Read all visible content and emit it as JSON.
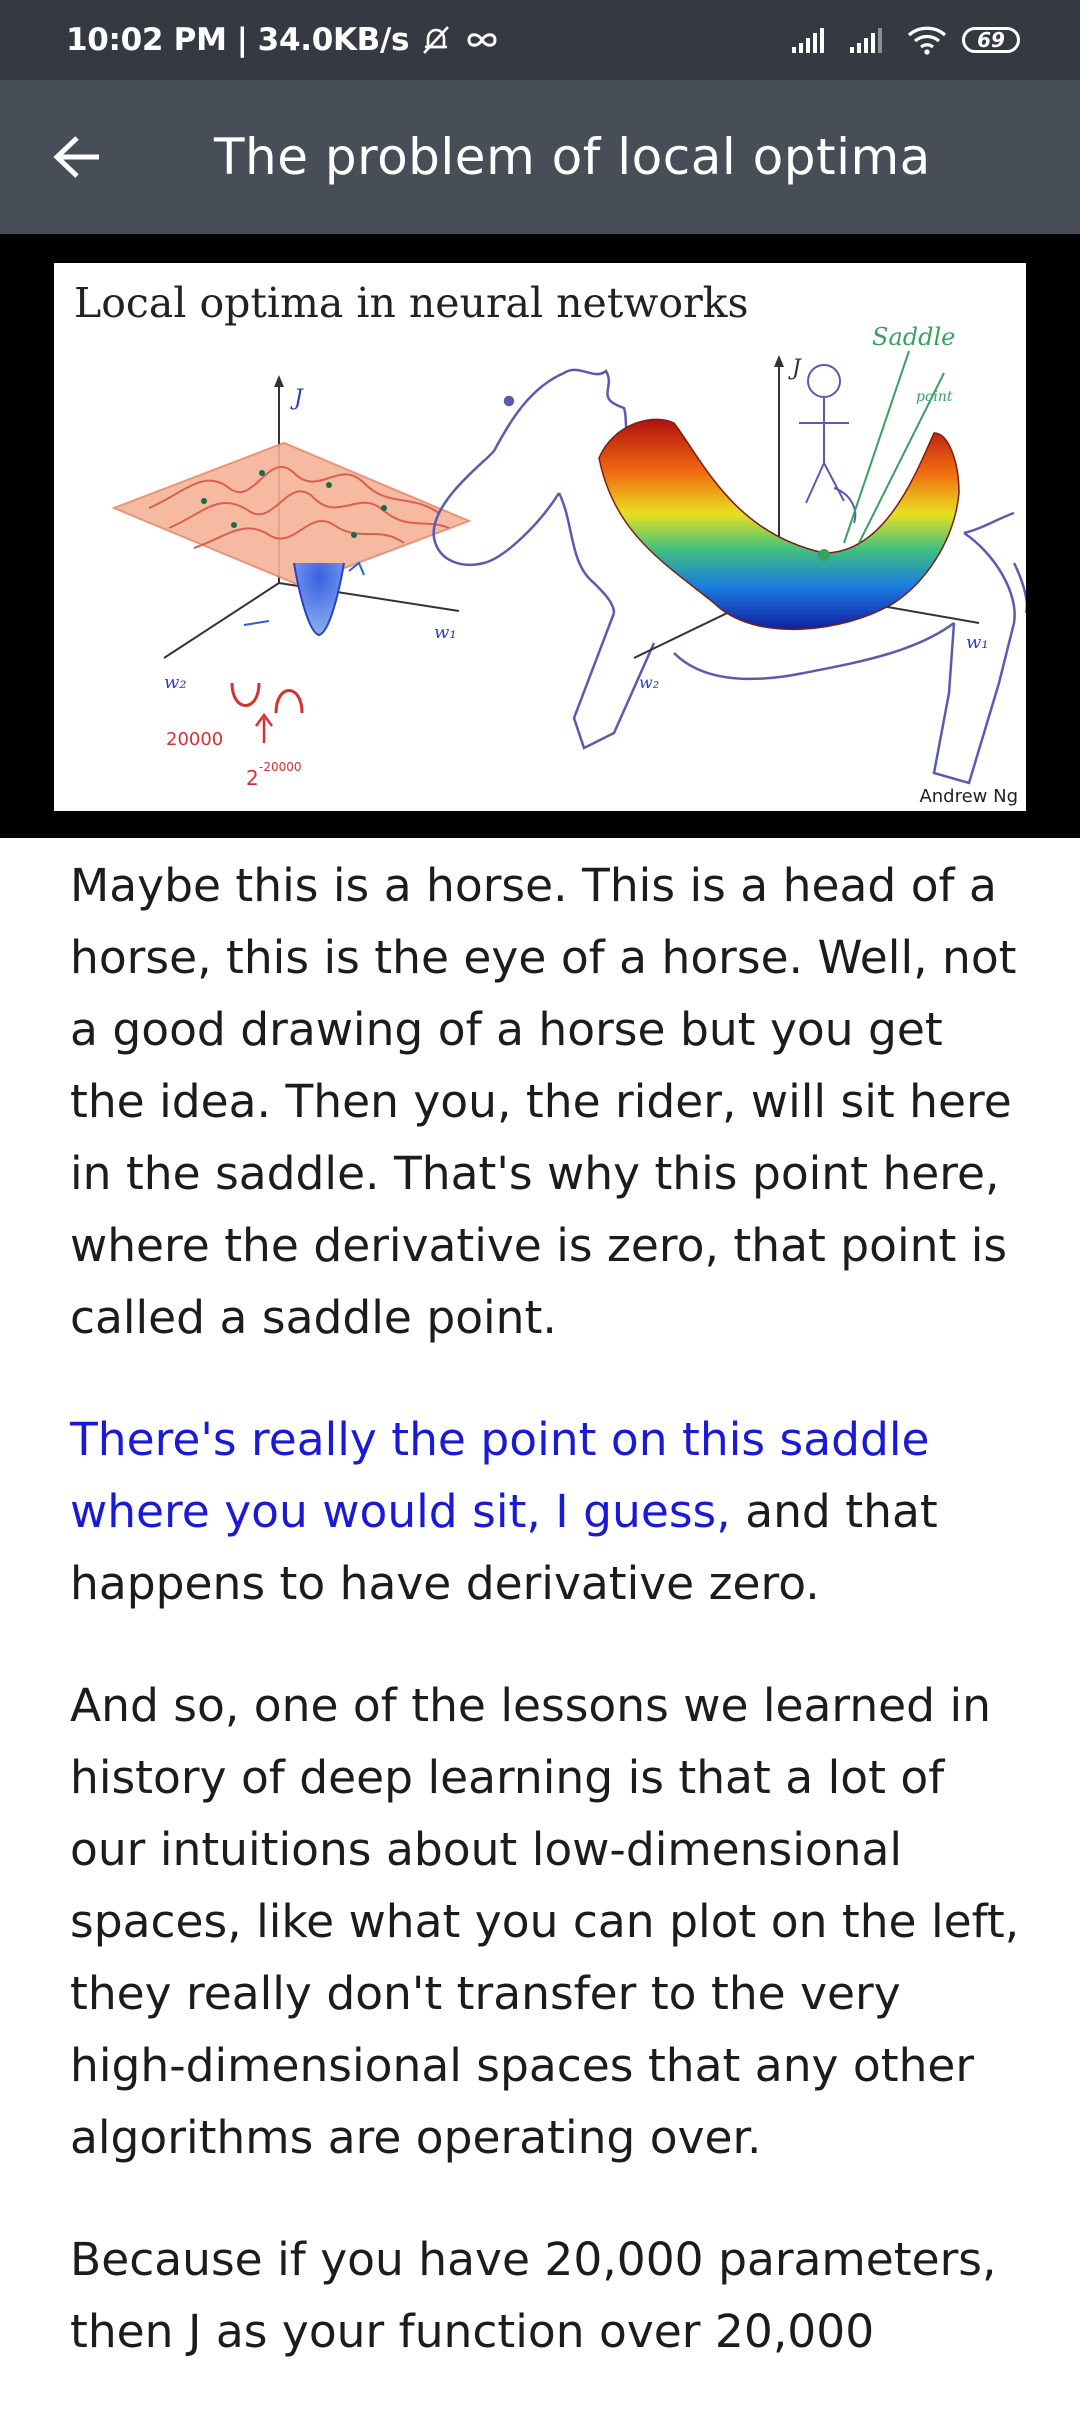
{
  "status_bar": {
    "time": "10:02 PM",
    "network_speed": "34.0KB/s",
    "battery_level": "69"
  },
  "app_bar": {
    "title": "The problem of local optima"
  },
  "slide": {
    "title": "Local optima in neural networks",
    "credit": "Andrew Ng",
    "annotations": {
      "axis_j_left": "J",
      "axis_w1_left": "w₁",
      "axis_w2_left": "w₂",
      "count_left": "20000",
      "exponent_left": "2",
      "exponent_power": "-20000",
      "axis_j_right": "J",
      "axis_w1_right": "w₁",
      "axis_w2_right": "w₂",
      "saddle_label_1": "Saddle",
      "saddle_label_2": "point"
    }
  },
  "article": {
    "p1": "Maybe this is a horse. This is a head of a horse, this is the eye of a horse. Well, not a good drawing of a horse but you get the idea. Then you, the rider, will sit here in the saddle. That's why this point here, where the derivative is zero, that point is called a saddle point.",
    "p2_highlight": "There's really the point on this saddle where you would sit, I guess,",
    "p2_rest": " and that happens to have derivative zero.",
    "p3": "And so, one of the lessons we learned in history of deep learning is that a lot of our intuitions about low-dimensional spaces, like what you can plot on the left, they really don't transfer to the very high-dimensional spaces that any other algorithms are operating over.",
    "p4": "Because if you have 20,000 parameters, then J as your function over 20,000"
  },
  "colors": {
    "status_bar_bg": "#353a42",
    "app_bar_bg": "#484e57",
    "highlight_text": "#1a1ad6"
  }
}
